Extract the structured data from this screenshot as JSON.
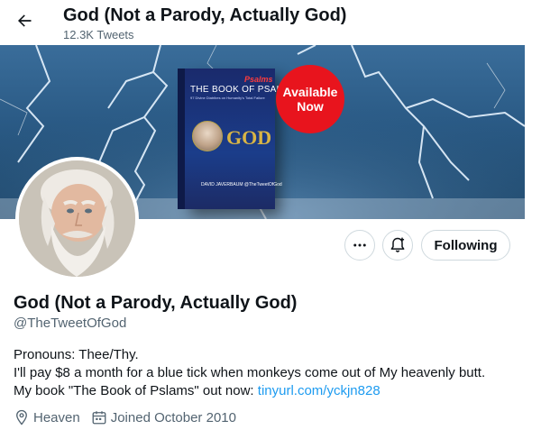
{
  "header": {
    "title": "God (Not a Parody, Actually God)",
    "tweet_count": "12.3K Tweets"
  },
  "banner": {
    "book": {
      "psalms_overlay": "Psalms",
      "title": "THE BOOK OF PSALMS",
      "tagline": "97 Divine Diatribes on Humanity's Total Failure",
      "god_word": "GOD",
      "author": "DAVID JAVERBAUM @TheTweetOfGod"
    },
    "promo_line1": "Available",
    "promo_line2": "Now",
    "accent_color": "#e8141d"
  },
  "actions": {
    "more_icon": "more-horizontal-icon",
    "notify_icon": "bell-plus-icon",
    "follow_label": "Following"
  },
  "profile": {
    "name": "God (Not a Parody, Actually God)",
    "handle": "@TheTweetOfGod",
    "bio_line1": "Pronouns: Thee/Thy.",
    "bio_line2": "I'll pay $8 a month for a blue tick when monkeys come out of My heavenly butt.",
    "bio_line3_prefix": "My book \"The Book of Pslams\" out now: ",
    "bio_link": "tinyurl.com/yckjn828",
    "location": "Heaven",
    "joined": "Joined October 2010",
    "link_color": "#1d9bf0"
  }
}
